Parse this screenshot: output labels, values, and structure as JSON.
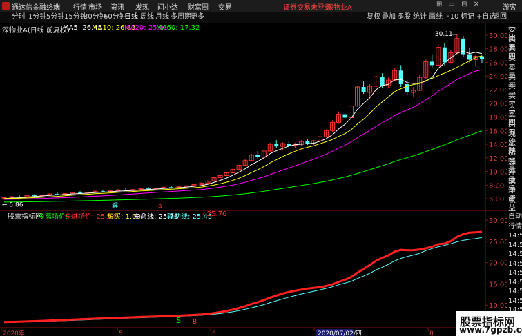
{
  "titlebar": {
    "app_title": "通达信金融终端",
    "menus": [
      "行情",
      "市场",
      "资讯",
      "发现",
      "问小达",
      "财富圈",
      "交易"
    ],
    "login_status": "证券交易未登录",
    "stock": "深物业A",
    "guest": "游客"
  },
  "toolbar": {
    "periods": [
      "分时",
      "1分钟",
      "5分钟",
      "15分钟",
      "30分钟",
      "60分钟",
      "日线",
      "周线",
      "月线",
      "多周期",
      "更多"
    ],
    "active_period": "日线",
    "right_buttons": [
      "复权",
      "叠加",
      "多股",
      "统计",
      "画线",
      "F10",
      "标记",
      "+自选",
      "返回"
    ]
  },
  "main_indicator": {
    "title": "深物业A(日线 前复权)",
    "ma5": "MA5: 26.45",
    "ma10": "MA10: 26.83",
    "ma20": "MA20: 25.01",
    "ma60": "MA60: 17.32",
    "high_label": "30.11",
    "low_label": "5.86",
    "marker_a": "解",
    "marker_b": "a"
  },
  "sub_indicator": {
    "title": "股票指标网",
    "label1": "今离场价: -",
    "label2": "今进场价: 25.94",
    "label3": "短买: 1.00",
    "label4": "生命线: 25.76",
    "label5": "辅助线: 25.45",
    "label6": "- 25.76"
  },
  "price_axis": [
    "30.00",
    "28.00",
    "26.00",
    "24.00",
    "22.00",
    "20.00",
    "18.00",
    "16.00",
    "14.00",
    "12.00",
    "10.00",
    "8.00",
    "6.00"
  ],
  "sub_axis": [
    "30.00",
    "25.00",
    "20.00",
    "15.00",
    "10.00"
  ],
  "date_axis": [
    "2020年",
    "5",
    "6",
    "7",
    "2020/07/02/四",
    "8"
  ],
  "right_panel": {
    "main_labels": [
      "委比",
      "卖五",
      "卖四",
      "卖三",
      "卖二",
      "卖一",
      "买一",
      "买二",
      "买三",
      "买四",
      "买五",
      "现价",
      "涨跌",
      "涨幅",
      "总量",
      "外盘",
      "换手",
      "净资",
      "收益"
    ],
    "sub_labels": [
      "自动",
      "行情",
      "14:50",
      "14:50",
      "14:50",
      "14:50",
      "14:50",
      "14:50",
      "14:50",
      "14:50",
      "14:50",
      "14:50"
    ]
  },
  "watermark": {
    "line1": "股票指标网",
    "line2": "www.7gpzb.com"
  },
  "colors": {
    "up": "#ff3232",
    "down": "#54ffff",
    "ma5": "#ffffff",
    "ma10": "#ffff00",
    "ma20": "#ff00ff",
    "ma60": "#00ff00",
    "axis": "#8a1010"
  },
  "chart_data": {
    "type": "candlestick",
    "price_range": [
      5,
      31
    ],
    "sub_range": [
      5,
      31
    ],
    "ohlc": [
      [
        6.1,
        6.3,
        5.86,
        6.2
      ],
      [
        6.2,
        6.4,
        6.1,
        6.3
      ],
      [
        6.3,
        6.5,
        6.2,
        6.25
      ],
      [
        6.25,
        6.6,
        6.2,
        6.5
      ],
      [
        6.5,
        6.7,
        6.4,
        6.45
      ],
      [
        6.45,
        6.6,
        6.3,
        6.55
      ],
      [
        6.55,
        6.8,
        6.5,
        6.7
      ],
      [
        6.7,
        6.9,
        6.6,
        6.65
      ],
      [
        6.65,
        6.8,
        6.5,
        6.75
      ],
      [
        6.75,
        7.0,
        6.7,
        6.9
      ],
      [
        6.9,
        7.1,
        6.8,
        6.85
      ],
      [
        6.85,
        7.0,
        6.7,
        6.95
      ],
      [
        6.95,
        7.2,
        6.9,
        7.1
      ],
      [
        7.1,
        7.3,
        7.0,
        7.05
      ],
      [
        7.05,
        7.2,
        6.9,
        7.15
      ],
      [
        7.15,
        7.4,
        7.1,
        7.3
      ],
      [
        7.3,
        7.5,
        7.2,
        7.25
      ],
      [
        7.25,
        7.4,
        7.1,
        7.35
      ],
      [
        7.35,
        7.6,
        7.3,
        7.5
      ],
      [
        7.5,
        7.7,
        7.4,
        7.45
      ],
      [
        7.45,
        7.6,
        7.3,
        7.55
      ],
      [
        7.55,
        7.8,
        7.5,
        7.7
      ],
      [
        7.7,
        7.9,
        7.6,
        7.65
      ],
      [
        7.65,
        7.8,
        7.5,
        7.75
      ],
      [
        7.75,
        8.0,
        7.7,
        7.9
      ],
      [
        7.9,
        8.2,
        7.8,
        8.1
      ],
      [
        8.1,
        8.4,
        8.0,
        8.3
      ],
      [
        8.3,
        8.7,
        8.2,
        8.6
      ],
      [
        8.6,
        9.2,
        8.5,
        9.1
      ],
      [
        9.1,
        9.6,
        9.0,
        9.4
      ],
      [
        9.4,
        9.9,
        9.3,
        9.8
      ],
      [
        9.8,
        10.4,
        9.7,
        10.3
      ],
      [
        10.3,
        11.0,
        10.2,
        10.9
      ],
      [
        10.9,
        11.8,
        10.8,
        11.6
      ],
      [
        11.6,
        12.6,
        11.5,
        12.4
      ],
      [
        12.4,
        13.0,
        11.9,
        12.1
      ],
      [
        12.1,
        13.2,
        12.0,
        13.0
      ],
      [
        13.0,
        14.2,
        12.9,
        14.0
      ],
      [
        14.0,
        14.6,
        13.5,
        13.7
      ],
      [
        13.7,
        14.3,
        13.2,
        14.1
      ],
      [
        14.1,
        14.5,
        13.6,
        13.8
      ],
      [
        13.8,
        14.2,
        13.4,
        14.0
      ],
      [
        14.0,
        14.6,
        13.8,
        14.4
      ],
      [
        14.4,
        14.8,
        13.9,
        14.1
      ],
      [
        14.1,
        14.6,
        13.9,
        14.5
      ],
      [
        14.5,
        15.2,
        14.4,
        15.1
      ],
      [
        15.1,
        16.2,
        15.0,
        16.0
      ],
      [
        16.0,
        17.5,
        15.8,
        17.2
      ],
      [
        17.2,
        18.8,
        17.0,
        18.4
      ],
      [
        18.4,
        19.0,
        17.6,
        17.9
      ],
      [
        17.9,
        19.8,
        17.8,
        19.6
      ],
      [
        19.6,
        22.6,
        19.5,
        22.4
      ],
      [
        22.4,
        23.2,
        21.4,
        21.6
      ],
      [
        21.6,
        22.8,
        21.0,
        22.5
      ],
      [
        22.5,
        24.2,
        22.3,
        23.9
      ],
      [
        23.9,
        24.4,
        22.2,
        22.6
      ],
      [
        22.6,
        23.8,
        22.3,
        23.4
      ],
      [
        23.4,
        25.2,
        23.2,
        24.8
      ],
      [
        24.8,
        25.6,
        22.4,
        22.8
      ],
      [
        22.8,
        23.4,
        21.2,
        21.6
      ],
      [
        21.6,
        22.4,
        21.0,
        21.9
      ],
      [
        21.9,
        24.2,
        21.8,
        23.8
      ],
      [
        23.8,
        26.4,
        23.6,
        26.1
      ],
      [
        26.1,
        27.2,
        25.2,
        25.6
      ],
      [
        25.6,
        28.6,
        25.4,
        28.2
      ],
      [
        28.2,
        28.8,
        25.6,
        26.0
      ],
      [
        26.0,
        27.8,
        25.8,
        27.4
      ],
      [
        27.4,
        30.11,
        27.2,
        29.5
      ],
      [
        29.5,
        29.9,
        26.8,
        27.2
      ],
      [
        27.2,
        28.2,
        26.0,
        26.4
      ],
      [
        26.4,
        27.2,
        25.4,
        26.9
      ],
      [
        26.9,
        27.0,
        25.9,
        26.45
      ]
    ],
    "ma_series": [
      {
        "name": "MA5",
        "color": "#ffffff"
      },
      {
        "name": "MA10",
        "color": "#ffff00"
      },
      {
        "name": "MA20",
        "color": "#ff00ff"
      },
      {
        "name": "MA60",
        "color": "#00ff00"
      }
    ],
    "sub_series": [
      {
        "name": "生命线",
        "color": "#ff2020"
      },
      {
        "name": "辅助线",
        "color": "#54ffff"
      }
    ]
  }
}
